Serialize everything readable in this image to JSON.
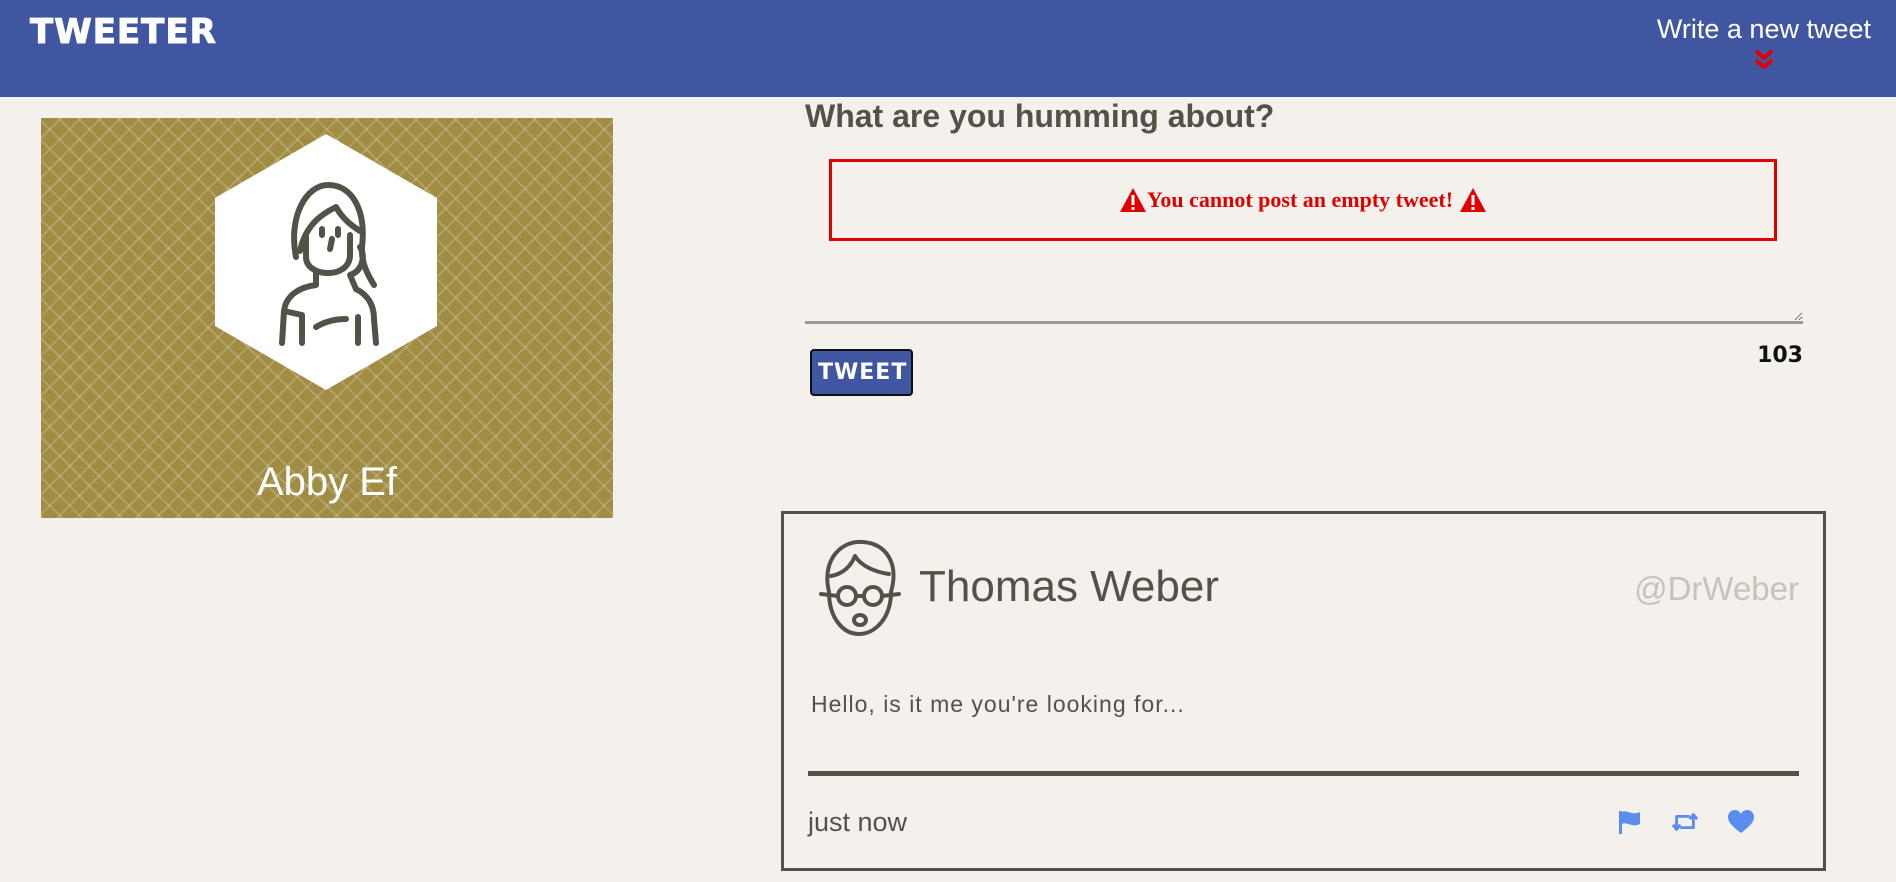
{
  "navbar": {
    "brand": "TWEETER",
    "compose_label": "Write a new tweet",
    "compose_arrow_icon": "double-chevron-down-icon",
    "background": "#4056a1",
    "arrow_color": "#e00000"
  },
  "profile": {
    "name": "Abby Ef",
    "avatar_icon": "woman-avatar-icon",
    "background": "#a08c42"
  },
  "compose": {
    "title": "What are you humming about?",
    "error": "You cannot post an empty tweet!",
    "error_icon": "warning-icon",
    "error_color": "#e00000",
    "textarea_value": "",
    "button_label": "TWEET",
    "counter": "103"
  },
  "tweets": [
    {
      "name": "Thomas Weber",
      "handle": "@DrWeber",
      "avatar_icon": "man-glasses-avatar-icon",
      "text": "Hello, is it me you're looking for...",
      "time": "just now",
      "actions": [
        {
          "icon": "flag-icon"
        },
        {
          "icon": "retweet-icon"
        },
        {
          "icon": "heart-icon"
        }
      ],
      "action_color": "#5b8dee"
    }
  ]
}
